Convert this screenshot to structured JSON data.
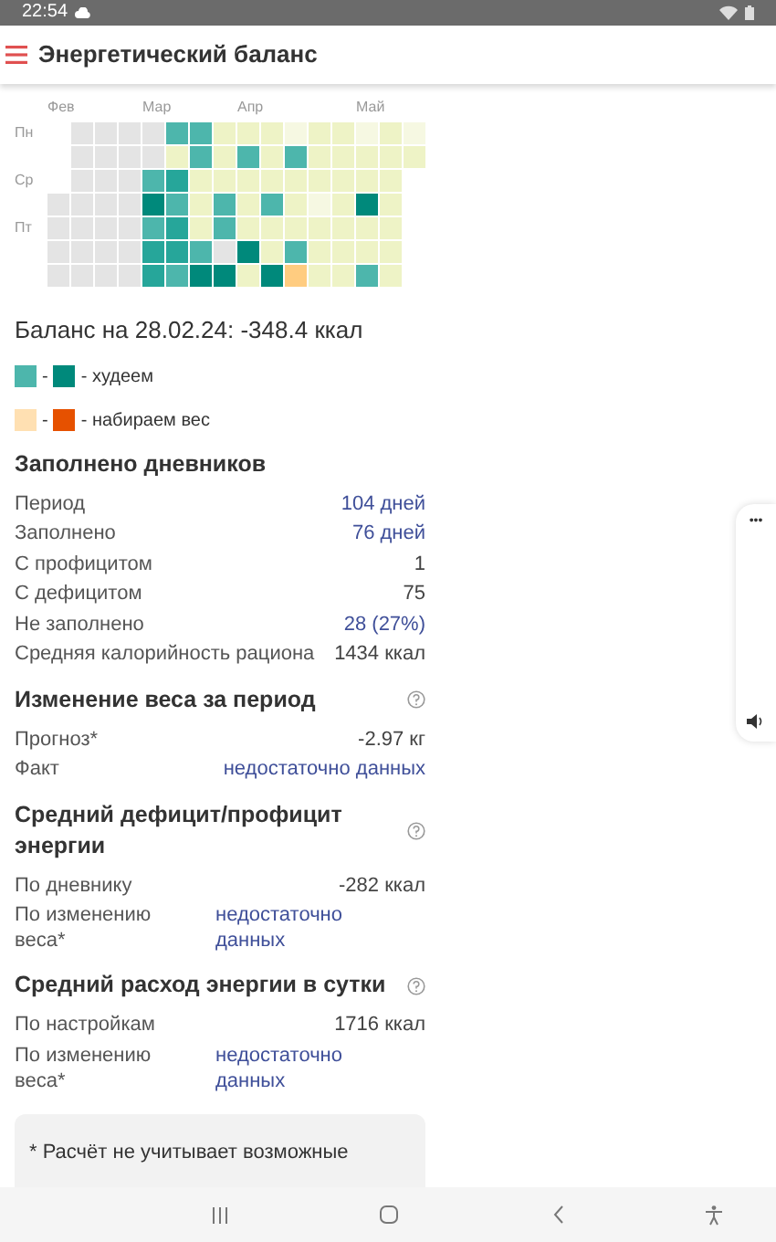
{
  "status_bar": {
    "time": "22:54"
  },
  "header": {
    "title": "Энергетический баланс"
  },
  "heatmap": {
    "rows": [
      {
        "label": "Пн",
        "cells": [
          {
            "kind": "empty",
            "month": "Фев"
          },
          {
            "kind": "day",
            "color": "#e4e4e4"
          },
          {
            "kind": "day",
            "color": "#e4e4e4"
          },
          {
            "kind": "day",
            "color": "#e4e4e4"
          },
          {
            "kind": "day",
            "color": "#e4e4e4",
            "month": "Мар"
          },
          {
            "kind": "day",
            "color": "#4db6ac"
          },
          {
            "kind": "day",
            "color": "#4db6ac"
          },
          {
            "kind": "day",
            "color": "#eef3c6"
          },
          {
            "kind": "day",
            "color": "#eef3c6",
            "month": "Апр"
          },
          {
            "kind": "day",
            "color": "#eef3c6"
          },
          {
            "kind": "day",
            "color": "#f6f8e2"
          },
          {
            "kind": "day",
            "color": "#eef3c6"
          },
          {
            "kind": "day",
            "color": "#eef3c6"
          },
          {
            "kind": "day",
            "color": "#f6f8e2",
            "month": "Май"
          },
          {
            "kind": "day",
            "color": "#eef3c6"
          },
          {
            "kind": "day",
            "color": "#f6f8e2"
          }
        ]
      },
      {
        "cells": [
          {
            "kind": "empty"
          },
          {
            "kind": "day",
            "color": "#e4e4e4"
          },
          {
            "kind": "day",
            "color": "#e4e4e4"
          },
          {
            "kind": "day",
            "color": "#e4e4e4"
          },
          {
            "kind": "day",
            "color": "#e4e4e4"
          },
          {
            "kind": "day",
            "color": "#eef3c6"
          },
          {
            "kind": "day",
            "color": "#4db6ac"
          },
          {
            "kind": "day",
            "color": "#eef3c6"
          },
          {
            "kind": "day",
            "color": "#4db6ac"
          },
          {
            "kind": "day",
            "color": "#eef3c6"
          },
          {
            "kind": "day",
            "color": "#4db6ac"
          },
          {
            "kind": "day",
            "color": "#eef3c6"
          },
          {
            "kind": "day",
            "color": "#eef3c6"
          },
          {
            "kind": "day",
            "color": "#eef3c6"
          },
          {
            "kind": "day",
            "color": "#eef3c6"
          },
          {
            "kind": "day",
            "color": "#eef3c6"
          }
        ]
      },
      {
        "label": "Ср",
        "cells": [
          {
            "kind": "empty"
          },
          {
            "kind": "day",
            "color": "#e4e4e4"
          },
          {
            "kind": "day",
            "color": "#e4e4e4"
          },
          {
            "kind": "day",
            "color": "#e4e4e4"
          },
          {
            "kind": "day",
            "color": "#4db6ac"
          },
          {
            "kind": "day",
            "color": "#26a69a"
          },
          {
            "kind": "day",
            "color": "#eef3c6"
          },
          {
            "kind": "day",
            "color": "#eef3c6"
          },
          {
            "kind": "day",
            "color": "#eef3c6"
          },
          {
            "kind": "day",
            "color": "#eef3c6"
          },
          {
            "kind": "day",
            "color": "#eef3c6"
          },
          {
            "kind": "day",
            "color": "#eef3c6"
          },
          {
            "kind": "day",
            "color": "#eef3c6"
          },
          {
            "kind": "day",
            "color": "#eef3c6"
          },
          {
            "kind": "day",
            "color": "#eef3c6"
          }
        ]
      },
      {
        "cells": [
          {
            "kind": "day",
            "color": "#e4e4e4"
          },
          {
            "kind": "day",
            "color": "#e4e4e4"
          },
          {
            "kind": "day",
            "color": "#e4e4e4"
          },
          {
            "kind": "day",
            "color": "#e4e4e4"
          },
          {
            "kind": "day",
            "color": "#00897b"
          },
          {
            "kind": "day",
            "color": "#4db6ac"
          },
          {
            "kind": "day",
            "color": "#eef3c6"
          },
          {
            "kind": "day",
            "color": "#4db6ac"
          },
          {
            "kind": "day",
            "color": "#eef3c6"
          },
          {
            "kind": "day",
            "color": "#4db6ac"
          },
          {
            "kind": "day",
            "color": "#eef3c6"
          },
          {
            "kind": "day",
            "color": "#f6f8e2"
          },
          {
            "kind": "day",
            "color": "#eef3c6"
          },
          {
            "kind": "day",
            "color": "#00897b"
          },
          {
            "kind": "day",
            "color": "#eef3c6"
          }
        ]
      },
      {
        "label": "Пт",
        "cells": [
          {
            "kind": "day",
            "color": "#e4e4e4"
          },
          {
            "kind": "day",
            "color": "#e4e4e4"
          },
          {
            "kind": "day",
            "color": "#e4e4e4"
          },
          {
            "kind": "day",
            "color": "#e4e4e4"
          },
          {
            "kind": "day",
            "color": "#4db6ac"
          },
          {
            "kind": "day",
            "color": "#26a69a"
          },
          {
            "kind": "day",
            "color": "#eef3c6"
          },
          {
            "kind": "day",
            "color": "#4db6ac"
          },
          {
            "kind": "day",
            "color": "#eef3c6"
          },
          {
            "kind": "day",
            "color": "#eef3c6"
          },
          {
            "kind": "day",
            "color": "#eef3c6"
          },
          {
            "kind": "day",
            "color": "#eef3c6"
          },
          {
            "kind": "day",
            "color": "#eef3c6"
          },
          {
            "kind": "day",
            "color": "#eef3c6"
          },
          {
            "kind": "day",
            "color": "#eef3c6"
          }
        ]
      },
      {
        "cells": [
          {
            "kind": "day",
            "color": "#e4e4e4"
          },
          {
            "kind": "day",
            "color": "#e4e4e4"
          },
          {
            "kind": "day",
            "color": "#e4e4e4"
          },
          {
            "kind": "day",
            "color": "#e4e4e4"
          },
          {
            "kind": "day",
            "color": "#26a69a"
          },
          {
            "kind": "day",
            "color": "#26a69a"
          },
          {
            "kind": "day",
            "color": "#4db6ac"
          },
          {
            "kind": "day",
            "color": "#e4e4e4"
          },
          {
            "kind": "day",
            "color": "#00897b"
          },
          {
            "kind": "day",
            "color": "#eef3c6"
          },
          {
            "kind": "day",
            "color": "#4db6ac"
          },
          {
            "kind": "day",
            "color": "#eef3c6"
          },
          {
            "kind": "day",
            "color": "#eef3c6"
          },
          {
            "kind": "day",
            "color": "#eef3c6"
          },
          {
            "kind": "day",
            "color": "#eef3c6"
          }
        ]
      },
      {
        "cells": [
          {
            "kind": "day",
            "color": "#e4e4e4"
          },
          {
            "kind": "day",
            "color": "#e4e4e4"
          },
          {
            "kind": "day",
            "color": "#e4e4e4"
          },
          {
            "kind": "day",
            "color": "#e4e4e4"
          },
          {
            "kind": "day",
            "color": "#26a69a"
          },
          {
            "kind": "day",
            "color": "#4db6ac"
          },
          {
            "kind": "day",
            "color": "#00897b"
          },
          {
            "kind": "day",
            "color": "#00897b"
          },
          {
            "kind": "day",
            "color": "#eef3c6"
          },
          {
            "kind": "day",
            "color": "#00897b"
          },
          {
            "kind": "day",
            "color": "#ffcc80"
          },
          {
            "kind": "day",
            "color": "#eef3c6"
          },
          {
            "kind": "day",
            "color": "#eef3c6"
          },
          {
            "kind": "day",
            "color": "#4db6ac"
          },
          {
            "kind": "day",
            "color": "#eef3c6"
          }
        ]
      }
    ]
  },
  "balance": "Баланс на 28.02.24: -348.4 ккал",
  "legend": [
    {
      "swatches": [
        {
          "color": "#4db6ac"
        },
        {
          "color": "#00897b"
        }
      ],
      "separator": "-",
      "label": "- худеем"
    },
    {
      "swatches": [
        {
          "color": "#ffe0b2"
        },
        {
          "color": "#e65100"
        }
      ],
      "separator": "-",
      "label": "- набираем вес"
    }
  ],
  "sections": [
    {
      "title": "Заполнено дневников",
      "help": false,
      "rows": [
        {
          "label": "Период",
          "value": "104 дней",
          "link": true,
          "kind": "line"
        },
        {
          "label": "Заполнено",
          "value": "76 дней",
          "link": true,
          "kind": "line"
        },
        {
          "label": "С профицитом",
          "value": "1",
          "link": false,
          "kind": "line"
        },
        {
          "label": "С дефицитом",
          "value": "75",
          "link": false,
          "kind": "line"
        },
        {
          "label": "Не заполнено",
          "value": "28 (27%)",
          "link": true,
          "kind": "line"
        },
        {
          "label": "Средняя калорийность рациона",
          "value": "1434 ккал",
          "link": false,
          "kind": "line"
        }
      ]
    },
    {
      "title": "Изменение веса за период",
      "help": true,
      "rows": [
        {
          "label": "Прогноз*",
          "value": "-2.97 кг",
          "link": false,
          "kind": "line"
        },
        {
          "label": "Факт",
          "value": "недостаточно данных",
          "link": true,
          "kind": "line"
        }
      ]
    },
    {
      "title": "Средний дефицит/профицит энергии",
      "help": true,
      "rows": [
        {
          "label": "По дневнику",
          "value": "-282 ккал",
          "link": false,
          "kind": "line"
        },
        {
          "label": "По изменению веса*",
          "value": "недостаточно данных",
          "link": true,
          "kind": "split"
        }
      ]
    },
    {
      "title": "Средний расход энергии в сутки",
      "help": true,
      "rows": [
        {
          "label": "По настройкам",
          "value": "1716 ккал",
          "link": false,
          "kind": "line"
        },
        {
          "label": "По изменению веса*",
          "value": "недостаточно данных",
          "link": true,
          "kind": "split"
        }
      ]
    }
  ],
  "footnote": "* Расчёт не учитывает возможные",
  "side_panel": {
    "menu": "•••"
  }
}
